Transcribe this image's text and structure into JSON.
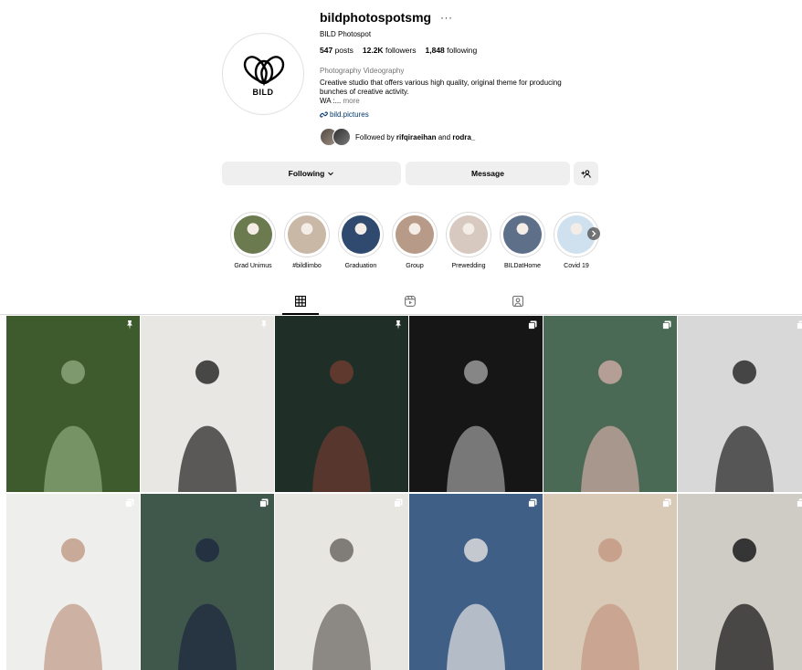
{
  "profile": {
    "username": "bildphotospotsmg",
    "more_dots": "···",
    "full_name": "BILD Photospot",
    "brand_logo_text": "BILD",
    "stats": {
      "posts_count": "547",
      "posts_label": "posts",
      "followers_count": "12.2K",
      "followers_label": "followers",
      "following_count": "1,848",
      "following_label": "following"
    },
    "category": "Photography Videography",
    "bio_line1": "Creative studio that offers various high quality, original theme for producing",
    "bio_line2": "bunches of creative activity.",
    "bio_line3": "WA :...",
    "more_label": "more",
    "link_text": "bild.pictures",
    "followed_by_prefix": "Followed by",
    "followed_by_user1": "rifqiraeihan",
    "followed_by_and": "and",
    "followed_by_user2": "rodra_"
  },
  "actions": {
    "following_label": "Following",
    "message_label": "Message",
    "add_user_icon": "add-person-icon"
  },
  "highlights": [
    {
      "label": "Grad Unimus",
      "color": "#6b7a4f"
    },
    {
      "label": "#bildlimbo",
      "color": "#c9b8a6"
    },
    {
      "label": "Graduation",
      "color": "#2f4a6e"
    },
    {
      "label": "Group",
      "color": "#b79a87"
    },
    {
      "label": "Prewedding",
      "color": "#d7c9c0"
    },
    {
      "label": "BILDatHome",
      "color": "#5e6f8a"
    },
    {
      "label": "Covid 19",
      "color": "#cfe0ef"
    }
  ],
  "tabs": [
    {
      "name": "posts-grid-icon",
      "active": true
    },
    {
      "name": "reels-icon",
      "active": false
    },
    {
      "name": "tagged-icon",
      "active": false
    }
  ],
  "posts": [
    {
      "bg": "#3d5b2c",
      "fg": "#8aa57a",
      "badge": "pin-icon"
    },
    {
      "bg": "#e9e7e4",
      "fg": "#2a2a2a",
      "badge": "pin-icon"
    },
    {
      "bg": "#1f2f27",
      "fg": "#6b3b30",
      "badge": "pin-icon"
    },
    {
      "bg": "#161616",
      "fg": "#9a9a9a",
      "badge": "carousel-icon"
    },
    {
      "bg": "#4a6a56",
      "fg": "#c7a7a0",
      "badge": "carousel-icon"
    },
    {
      "bg": "#d8d8d8",
      "fg": "#2b2b2b",
      "badge": "carousel-icon"
    },
    {
      "bg": "#eeeeec",
      "fg": "#c29c8a",
      "badge": "carousel-icon"
    },
    {
      "bg": "#40584c",
      "fg": "#1f2a3f",
      "badge": "carousel-icon"
    },
    {
      "bg": "#e8e6e1",
      "fg": "#6d6a66",
      "badge": "carousel-icon"
    },
    {
      "bg": "#3f5f87",
      "fg": "#dcdcdc",
      "badge": "carousel-icon"
    },
    {
      "bg": "#d9c9b7",
      "fg": "#c49a86",
      "badge": "carousel-icon"
    },
    {
      "bg": "#cfcbc5",
      "fg": "#1b1b1b",
      "badge": "carousel-icon"
    }
  ]
}
